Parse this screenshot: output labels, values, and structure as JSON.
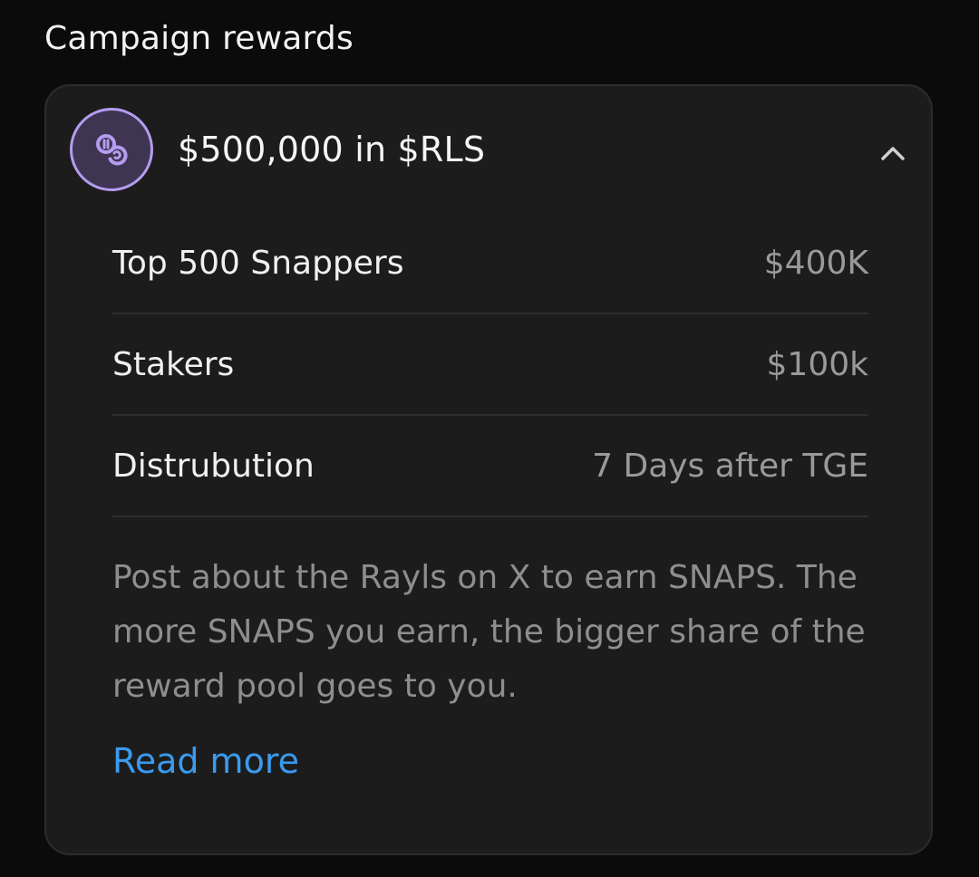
{
  "section": {
    "title": "Campaign rewards"
  },
  "reward": {
    "amount": "$500,000 in $RLS",
    "icon": "coins-icon",
    "icon_color": "#b59cf0",
    "expanded": true,
    "rows": [
      {
        "label": "Top 500 Snappers",
        "value": "$400K"
      },
      {
        "label": "Stakers",
        "value": "$100k"
      },
      {
        "label": "Distrubution",
        "value": "7 Days after TGE"
      }
    ],
    "description": "Post about the Rayls on X to earn SNAPS. The more SNAPS you earn, the bigger share of the reward pool goes to you.",
    "read_more": "Read more",
    "link_color": "#3a9bf0"
  }
}
